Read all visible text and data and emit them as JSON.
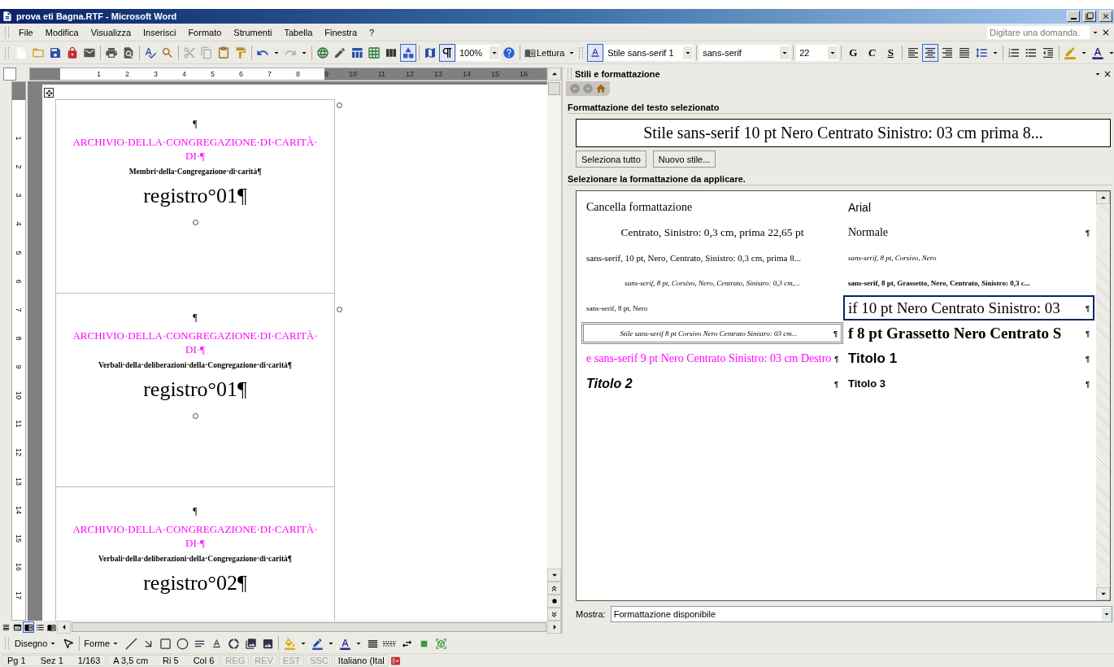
{
  "window": {
    "title": "prova eti Bagna.RTF - Microsoft Word"
  },
  "menu": [
    "File",
    "Modifica",
    "Visualizza",
    "Inserisci",
    "Formato",
    "Strumenti",
    "Tabella",
    "Finestra",
    "?"
  ],
  "help_search": {
    "placeholder": "Digitare una domanda."
  },
  "standard_toolbar": {
    "buttons": [
      {
        "pressed": false,
        "disabled": false
      },
      {
        "pressed": false,
        "disabled": false
      },
      {
        "pressed": false,
        "disabled": false
      },
      {
        "pressed": false,
        "disabled": false
      },
      {
        "pressed": false,
        "disabled": false
      },
      {
        "pressed": false,
        "disabled": false
      },
      {
        "pressed": false,
        "disabled": false
      },
      {
        "pressed": false,
        "disabled": false
      },
      {
        "pressed": false,
        "disabled": false
      },
      {
        "pressed": false,
        "disabled": true
      },
      {
        "pressed": false,
        "disabled": true
      },
      {
        "pressed": false,
        "disabled": false
      },
      {
        "pressed": false,
        "disabled": false
      },
      {
        "pressed": false,
        "disabled": false
      },
      {
        "pressed": false,
        "disabled": true
      },
      {
        "pressed": false,
        "disabled": false
      },
      {
        "pressed": false,
        "disabled": false
      },
      {
        "pressed": false,
        "disabled": false
      },
      {
        "pressed": false,
        "disabled": false
      },
      {
        "pressed": false,
        "disabled": false
      },
      {
        "pressed": true,
        "disabled": false
      },
      {
        "pressed": false,
        "disabled": false
      },
      {
        "pressed": true,
        "disabled": false
      }
    ],
    "zoom": "100%",
    "reading": "Lettura"
  },
  "formatting_toolbar": {
    "style": "Stile sans-serif 1",
    "font": "sans-serif",
    "size": "22",
    "text_buttons": [
      {
        "label": "G",
        "pressed": false
      },
      {
        "label": "C",
        "pressed": false
      },
      {
        "label": "S",
        "pressed": false
      }
    ],
    "buttons": [
      {
        "pressed": true
      },
      {
        "pressed": false
      },
      {
        "pressed": true
      },
      {
        "pressed": false
      },
      {
        "pressed": false
      },
      {
        "pressed": false
      },
      {
        "pressed": false
      },
      {
        "pressed": false
      },
      {
        "pressed": false
      },
      {
        "pressed": false
      },
      {
        "pressed": false
      }
    ]
  },
  "ruler": {
    "marks": [
      "1",
      "2",
      "3",
      "4",
      "5",
      "6",
      "7",
      "8",
      "9",
      "10",
      "11",
      "12",
      "13",
      "14",
      "15",
      "16"
    ]
  },
  "vertical_ruler": {
    "marks": [
      "1",
      "2",
      "3",
      "4",
      "5",
      "6",
      "7",
      "8",
      "9",
      "10",
      "11",
      "12",
      "13",
      "14",
      "15",
      "16",
      "17"
    ]
  },
  "document": {
    "rows": [
      {
        "mark": "¶",
        "title_lines": [
          "ARCHIVIO·DELLA·CONGREGAZIONE·DI·CARITÀ·",
          "DI·¶"
        ],
        "subtitle": "Membri·della·Congregazione·di·carità¶",
        "register": "registro°01¶",
        "end_mark": true
      },
      {
        "mark": "¶",
        "title_lines": [
          "ARCHIVIO·DELLA·CONGREGAZIONE·DI·CARITÀ·",
          "DI·¶"
        ],
        "subtitle": "Verbali·della·deliberazioni·della·Congregazione·di·carità¶",
        "register": "registro°01¶",
        "end_mark": true
      },
      {
        "mark": "¶",
        "title_lines": [
          "ARCHIVIO·DELLA·CONGREGAZIONE·DI·CARITÀ·",
          "DI·¶"
        ],
        "subtitle": "Verbali·della·deliberazioni·della·Congregazione·di·carità¶",
        "register": "registro°02¶",
        "end_mark": false
      }
    ]
  },
  "view_buttons": [
    {
      "selected": false
    },
    {
      "selected": false
    },
    {
      "selected": true
    },
    {
      "selected": false
    },
    {
      "selected": false
    }
  ],
  "task_pane": {
    "title": "Stili e formattazione",
    "selected_heading": "Formattazione del testo selezionato",
    "selected_format": "Stile sans-serif 10 pt Nero Centrato Sinistro:  03 cm prima 8...",
    "buttons": [
      "Seleziona tutto",
      "Nuovo stile..."
    ],
    "apply_heading": "Selezionare la formattazione da applicare.",
    "styles": [
      {
        "label": "Cancella formattazione",
        "kind": "serif-medium",
        "selected": false,
        "hovered": false
      },
      {
        "label": "Arial",
        "kind": "sans-medium",
        "selected": false,
        "hovered": false
      },
      {
        "label": "Centrato, Sinistro:  0,3 cm, prima 22,65 pt",
        "kind": "serif-medium-centered",
        "selected": false,
        "hovered": false
      },
      {
        "label": "Normale",
        "kind": "serif-medium",
        "mark": "¶",
        "selected": false,
        "hovered": false
      },
      {
        "label": "sans-serif, 10 pt, Nero, Centrato, Sinistro:  0,3 cm, prima 8...",
        "kind": "serif-small",
        "selected": false,
        "hovered": false
      },
      {
        "label": "sans-serif, 8 pt, Corsivo, Nero",
        "kind": "serif-tiny-italic",
        "selected": false,
        "hovered": false
      },
      {
        "label": "sans-serif, 8 pt, Corsivo, Nero, Centrato, Sinistro:  0,3 cm,...",
        "kind": "serif-tiny-italic-centered",
        "selected": false,
        "hovered": false
      },
      {
        "label": "sans-serif, 8 pt, Grassetto, Nero, Centrato, Sinistro:  0,3 c...",
        "kind": "serif-tiny-bold",
        "selected": false,
        "hovered": false
      },
      {
        "label": "sans-serif, 8 pt, Nero",
        "kind": "serif-tiny",
        "selected": false,
        "hovered": false
      },
      {
        "label": "if 10 pt Nero Centrato Sinistro:  03",
        "kind": "serif-large",
        "mark": "¶",
        "selected": true,
        "hovered": false
      },
      {
        "label": "Stile sans-serif 8 pt Corsivo Nero Centrato Sinistro:  03 cm...",
        "kind": "serif-tiny-italic-centered",
        "mark": "¶",
        "selected": false,
        "hovered": true
      },
      {
        "label": "f 8 pt Grassetto Nero Centrato S",
        "kind": "serif-large-bold",
        "mark": "¶",
        "selected": false,
        "hovered": false
      },
      {
        "label": "e sans-serif 9 pt Nero Centrato Sinistro:  03 cm Destro",
        "kind": "serif-medium",
        "color": "#ff00ff",
        "mark": "¶",
        "selected": false,
        "hovered": false
      },
      {
        "label": "Titolo 1",
        "kind": "heading-1",
        "mark": "¶",
        "selected": false,
        "hovered": false
      },
      {
        "label": "Titolo 2",
        "kind": "heading-2",
        "mark": "¶",
        "selected": false,
        "hovered": false
      },
      {
        "label": "Titolo 3",
        "kind": "heading-3",
        "mark": "¶",
        "selected": false,
        "hovered": false
      }
    ],
    "show_label": "Mostra:",
    "show_value": "Formattazione disponibile"
  },
  "drawing_toolbar": {
    "draw_menu": "Disegno",
    "shapes_menu": "Forme"
  },
  "status_bar": {
    "fields": [
      "Pg 1",
      "Sez 1",
      "1/163",
      "A 3,5 cm",
      "Ri 5",
      "Col 6"
    ],
    "modes": [
      {
        "label": "REG",
        "enabled": false
      },
      {
        "label": "REV",
        "enabled": false
      },
      {
        "label": "EST",
        "enabled": false
      },
      {
        "label": "SSC",
        "enabled": false
      }
    ],
    "language": "Italiano (Ital"
  }
}
